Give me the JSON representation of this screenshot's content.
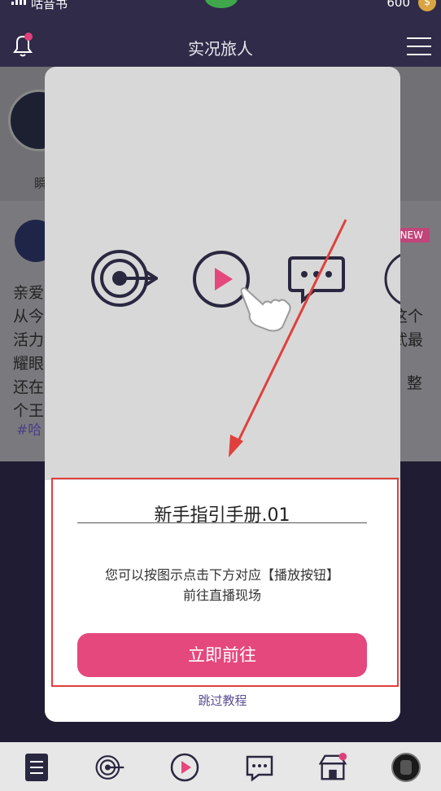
{
  "status_bar": {
    "carrier": "咕音书",
    "coins": "600",
    "coin_symbol": "$"
  },
  "header": {
    "title": "实况旅人"
  },
  "background": {
    "name": "瞬",
    "lines_left": [
      "亲爱",
      "从今",
      "活力",
      "耀眼",
      "还在",
      "个王"
    ],
    "lines_right": [
      "这个",
      "武最",
      "整"
    ],
    "tag": "#哈",
    "new_badge": "NEW"
  },
  "modal": {
    "guide_title": "新手指引手册.01",
    "guide_desc_line1": "您可以按图示点击下方对应【播放按钮】",
    "guide_desc_line2": "前往直播现场",
    "go_button": "立即前往",
    "skip_link": "跳过教程"
  },
  "colors": {
    "accent": "#e5487c",
    "header_bg": "#2f2b48",
    "highlight_box": "#e0403c",
    "skip_link": "#5c4f94"
  }
}
